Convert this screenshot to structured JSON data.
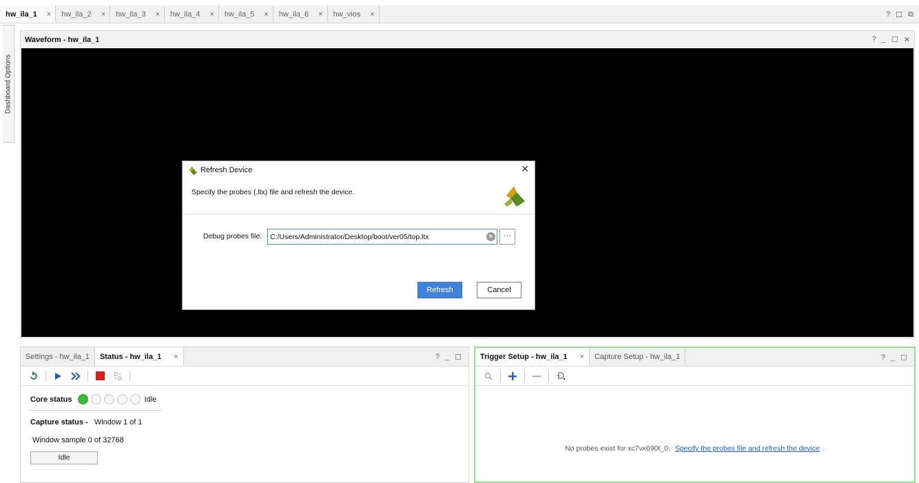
{
  "top_tabs": [
    {
      "label": "hw_ila_1",
      "active": true
    },
    {
      "label": "hw_ila_2",
      "active": false
    },
    {
      "label": "hw_ila_3",
      "active": false
    },
    {
      "label": "hw_ila_4",
      "active": false
    },
    {
      "label": "hw_ila_5",
      "active": false
    },
    {
      "label": "hw_ila_6",
      "active": false
    },
    {
      "label": "hw_vios",
      "active": false
    }
  ],
  "tab_close_glyph": "×",
  "window_controls": {
    "help": "?",
    "restore": "☐",
    "float": "⧉"
  },
  "side_tab": {
    "label": "Dashboard Options"
  },
  "waveform": {
    "title": "Waveform - hw_ila_1",
    "controls": {
      "help": "?",
      "minimize": "_",
      "maximize": "☐",
      "close": "✕"
    }
  },
  "dialog": {
    "title": "Refresh Device",
    "close": "✕",
    "description": "Specify the probes (.ltx) file and refresh the device.",
    "field_label": "Debug probes file:",
    "field_value": "C:/Users/Administrator/Desktop/boot/ver05/top.ltx",
    "clear_glyph": "✕",
    "browse_label": "···",
    "refresh_label": "Refresh",
    "cancel_label": "Cancel",
    "accent_color": "#3f80d8"
  },
  "left_panel": {
    "tabs": [
      {
        "label": "Settings - hw_ila_1",
        "active": false
      },
      {
        "label": "Status - hw_ila_1",
        "active": true
      }
    ],
    "close_glyph": "×",
    "controls": {
      "help": "?",
      "minimize": "_",
      "maximize": "☐"
    },
    "toolbar_icons": [
      "run-trigger-immediate-icon",
      "run-trigger-icon",
      "run-trigger-continuous-icon",
      "stop-trigger-icon",
      "toggle-view-icon"
    ],
    "core_status_label": "Core status",
    "core_status_leds": [
      true,
      false,
      false,
      false,
      false
    ],
    "core_status_value": "Idle",
    "capture_status_label": "Capture status -",
    "capture_status_value": "Window 1 of 1",
    "window_sample": "Window sample 0 of 32768",
    "state_button": "Idle",
    "led_on_color": "#3dbb3d"
  },
  "right_panel": {
    "tabs": [
      {
        "label": "Trigger Setup - hw_ila_1",
        "active": true
      },
      {
        "label": "Capture Setup - hw_ila_1",
        "active": false
      }
    ],
    "close_glyph": "×",
    "controls": {
      "help": "?",
      "minimize": "_",
      "maximize": "☐"
    },
    "toolbar_icons": [
      "search-icon",
      "add-probe-icon",
      "remove-probe-icon",
      "trigger-condition-icon"
    ],
    "message_prefix": "No probes exist for xc7vx690t_0.",
    "message_link": "Specify the probes file and refresh the device",
    "message_suffix": ".",
    "border_color": "#8fe08f"
  }
}
